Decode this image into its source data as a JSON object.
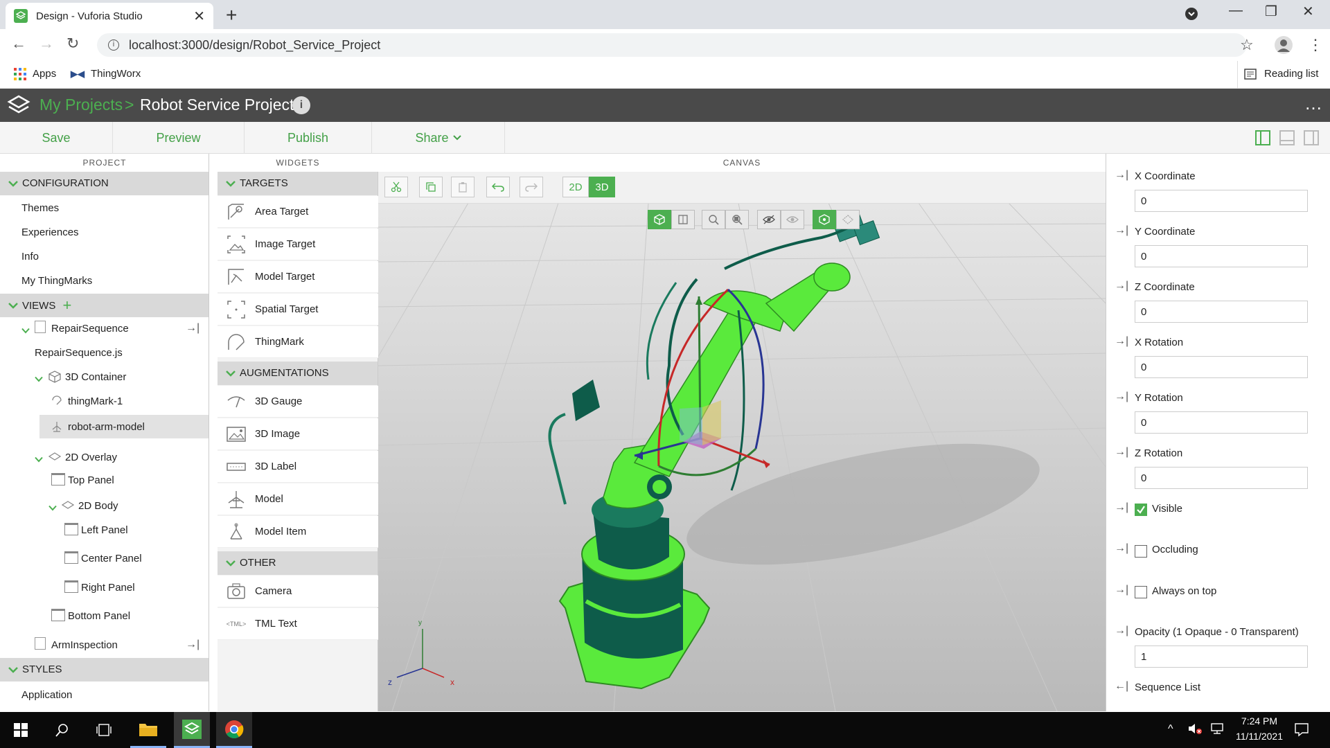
{
  "browser": {
    "tab_title": "Design - Vuforia Studio",
    "url": "localhost:3000/design/Robot_Service_Project",
    "bookmarks": [
      "Apps",
      "ThingWorx"
    ],
    "reading_list": "Reading list"
  },
  "header": {
    "breadcrumb_root": "My Projects",
    "separator": ">",
    "project_title": "Robot Service Project"
  },
  "toolbar": {
    "save": "Save",
    "preview": "Preview",
    "publish": "Publish",
    "share": "Share"
  },
  "columns": {
    "project": "PROJECT",
    "widgets": "WIDGETS",
    "canvas": "CANVAS"
  },
  "project": {
    "configuration": "CONFIGURATION",
    "config_items": [
      "Themes",
      "Experiences",
      "Info",
      "My ThingMarks"
    ],
    "views": "VIEWS",
    "tree": {
      "repair_sequence": "RepairSequence",
      "repair_sequence_js": "RepairSequence.js",
      "container_3d": "3D Container",
      "thingmark": "thingMark-1",
      "robot_model": "robot-arm-model",
      "overlay_2d": "2D Overlay",
      "top_panel": "Top Panel",
      "body_2d": "2D Body",
      "left_panel": "Left Panel",
      "center_panel": "Center Panel",
      "right_panel": "Right Panel",
      "bottom_panel": "Bottom Panel",
      "arm_inspection": "ArmInspection"
    },
    "styles": "STYLES",
    "application": "Application"
  },
  "widgets": {
    "targets": "TARGETS",
    "target_items": [
      "Area Target",
      "Image Target",
      "Model Target",
      "Spatial Target",
      "ThingMark"
    ],
    "augmentations": "AUGMENTATIONS",
    "augmentation_items": [
      "3D Gauge",
      "3D Image",
      "3D Label",
      "Model",
      "Model Item"
    ],
    "other": "OTHER",
    "other_items": [
      "Camera",
      "TML Text"
    ]
  },
  "canvas": {
    "mode_2d": "2D",
    "mode_3d": "3D",
    "axis_z": "z",
    "axis_x": "x",
    "axis_y": "y"
  },
  "properties": {
    "x_coord": {
      "label": "X Coordinate",
      "value": "0"
    },
    "y_coord": {
      "label": "Y Coordinate",
      "value": "0"
    },
    "z_coord": {
      "label": "Z Coordinate",
      "value": "0"
    },
    "x_rot": {
      "label": "X Rotation",
      "value": "0"
    },
    "y_rot": {
      "label": "Y Rotation",
      "value": "0"
    },
    "z_rot": {
      "label": "Z Rotation",
      "value": "0"
    },
    "visible": {
      "label": "Visible",
      "checked": true
    },
    "occluding": {
      "label": "Occluding",
      "checked": false
    },
    "always_on_top": {
      "label": "Always on top",
      "checked": false
    },
    "opacity": {
      "label": "Opacity (1 Opaque - 0 Transparent)",
      "value": "1"
    },
    "sequence_list": {
      "label": "Sequence List"
    }
  },
  "taskbar": {
    "time": "7:24 PM",
    "date": "11/11/2021"
  },
  "colors": {
    "accent": "#4caf50",
    "header_bg": "#4a4a4a",
    "canvas_bg": "#d3d3d3",
    "model_green": "#5aea3c",
    "model_dark": "#0e5c4a"
  }
}
